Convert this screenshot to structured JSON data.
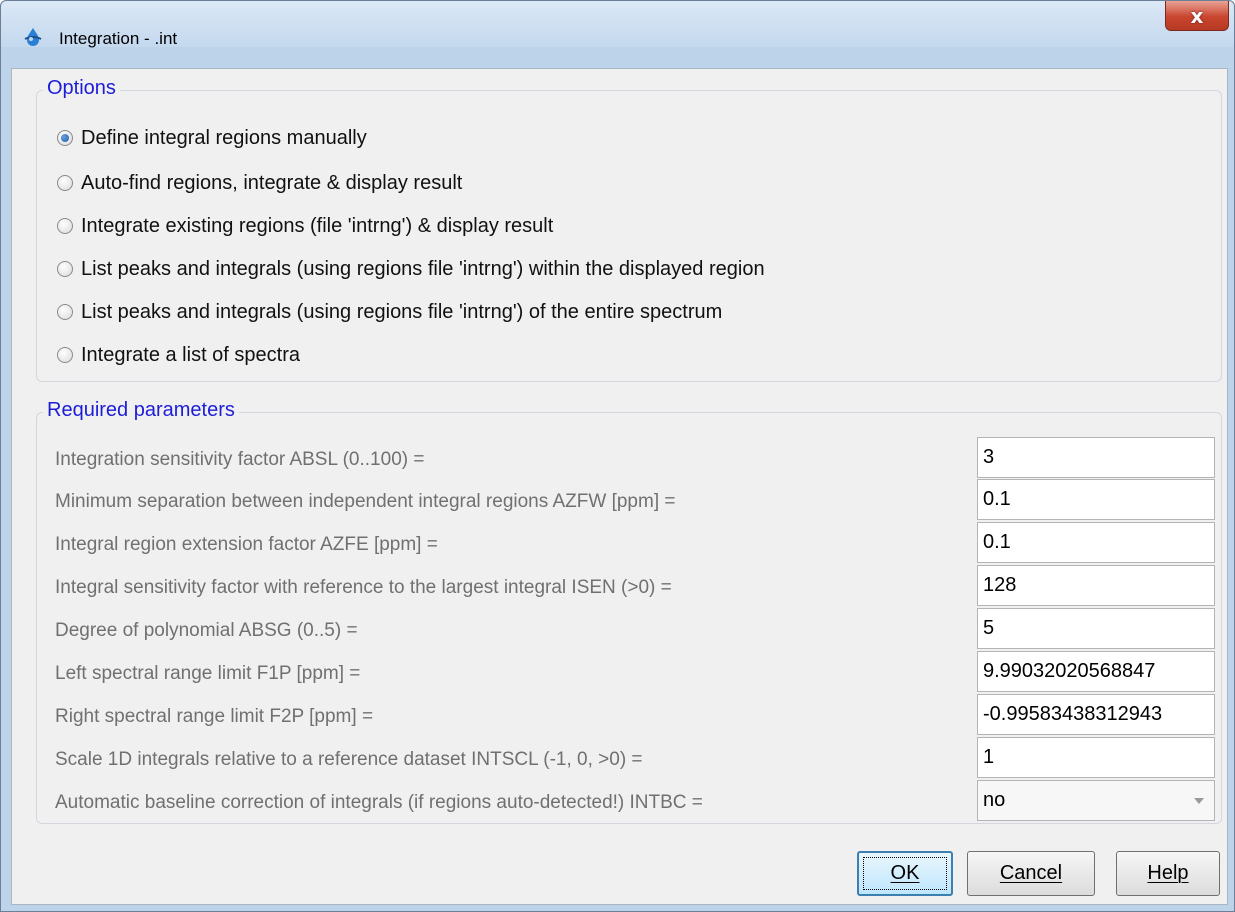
{
  "window": {
    "title": "Integration - .int",
    "close_label": "x"
  },
  "options": {
    "legend": "Options",
    "items": [
      {
        "label": "Define integral regions manually",
        "checked": true
      },
      {
        "label": "Auto-find regions, integrate & display result",
        "checked": false
      },
      {
        "label": "Integrate existing regions (file 'intrng') & display result",
        "checked": false
      },
      {
        "label": "List peaks and integrals (using regions file 'intrng') within the displayed region",
        "checked": false
      },
      {
        "label": "List peaks and integrals (using regions file 'intrng') of the entire spectrum",
        "checked": false
      },
      {
        "label": "Integrate a list of spectra",
        "checked": false
      }
    ]
  },
  "params": {
    "legend": "Required parameters",
    "rows": [
      {
        "label": "Integration sensitivity factor ABSL (0..100) =",
        "value": "3"
      },
      {
        "label": "Minimum separation between independent integral regions AZFW [ppm] =",
        "value": "0.1"
      },
      {
        "label": "Integral region extension factor AZFE [ppm] =",
        "value": "0.1"
      },
      {
        "label": "Integral sensitivity factor with reference to the largest integral ISEN (>0) =",
        "value": "128"
      },
      {
        "label": "Degree of polynomial ABSG (0..5) =",
        "value": "5"
      },
      {
        "label": "Left spectral range limit F1P [ppm] =",
        "value": "9.99032020568847"
      },
      {
        "label": "Right spectral range limit F2P [ppm] =",
        "value": "-0.99583438312943"
      },
      {
        "label": "Scale 1D integrals relative to a reference dataset INTSCL (-1, 0, >0) =",
        "value": "1"
      },
      {
        "label": "Automatic baseline correction of integrals (if regions auto-detected!) INTBC =",
        "value": "no"
      }
    ]
  },
  "buttons": {
    "ok": "OK",
    "cancel": "Cancel",
    "help": "Help"
  }
}
